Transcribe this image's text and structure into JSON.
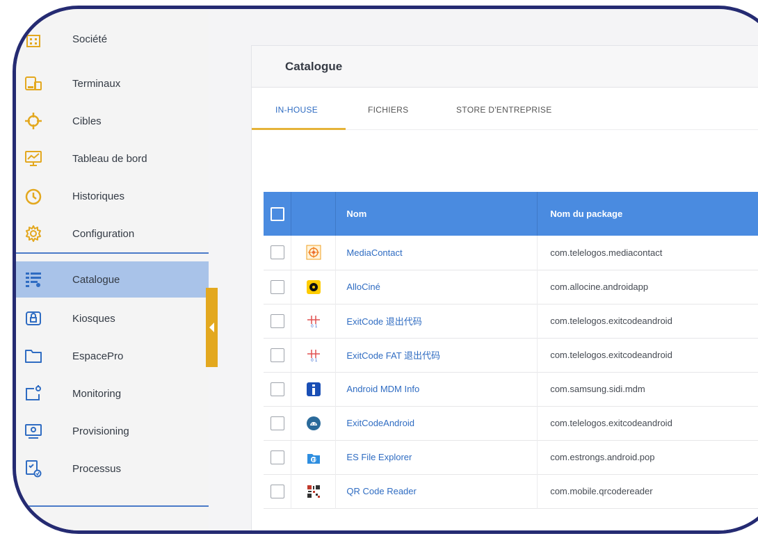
{
  "sidebar": {
    "items": [
      {
        "label": "Société",
        "icon": "building-icon"
      },
      {
        "label": "Terminaux",
        "icon": "devices-icon"
      },
      {
        "label": "Cibles",
        "icon": "crosshair-icon"
      },
      {
        "label": "Tableau de bord",
        "icon": "dashboard-icon"
      },
      {
        "label": "Historiques",
        "icon": "clock-icon"
      },
      {
        "label": "Configuration",
        "icon": "gear-icon"
      },
      {
        "label": "Catalogue",
        "icon": "catalog-list-icon",
        "active": true
      },
      {
        "label": "Kiosques",
        "icon": "kiosk-lock-icon"
      },
      {
        "label": "EspacePro",
        "icon": "folder-icon"
      },
      {
        "label": "Monitoring",
        "icon": "monitoring-icon"
      },
      {
        "label": "Provisioning",
        "icon": "provisioning-icon"
      },
      {
        "label": "Processus",
        "icon": "process-icon"
      }
    ]
  },
  "main": {
    "title": "Catalogue",
    "tabs": [
      {
        "label": "IN-HOUSE",
        "active": true
      },
      {
        "label": "FICHIERS"
      },
      {
        "label": "STORE D'ENTREPRISE"
      }
    ],
    "table": {
      "columns": {
        "name": "Nom",
        "package": "Nom du package"
      },
      "rows": [
        {
          "name": "MediaContact",
          "package": "com.telelogos.mediacontact",
          "icon": "mediacontact-icon"
        },
        {
          "name": "AlloCiné",
          "package": "com.allocine.androidapp",
          "icon": "allocine-icon"
        },
        {
          "name": "ExitCode 退出代码",
          "package": "com.telelogos.exitcodeandroid",
          "icon": "exitcode-icon"
        },
        {
          "name": "ExitCode FAT 退出代码",
          "package": "com.telelogos.exitcodeandroid",
          "icon": "exitcode-icon"
        },
        {
          "name": "Android MDM Info",
          "package": "com.samsung.sidi.mdm",
          "icon": "info-icon"
        },
        {
          "name": "ExitCodeAndroid",
          "package": "com.telelogos.exitcodeandroid",
          "icon": "android-icon"
        },
        {
          "name": "ES File Explorer",
          "package": "com.estrongs.android.pop",
          "icon": "es-file-explorer-icon"
        },
        {
          "name": "QR Code Reader",
          "package": "com.mobile.qrcodereader",
          "icon": "qr-code-icon"
        }
      ]
    }
  },
  "colors": {
    "accent": "#e3a81f",
    "header_blue": "#4a8be0",
    "active_nav": "#a9c3e9",
    "frame": "#252b72",
    "link": "#2f6cc2"
  }
}
